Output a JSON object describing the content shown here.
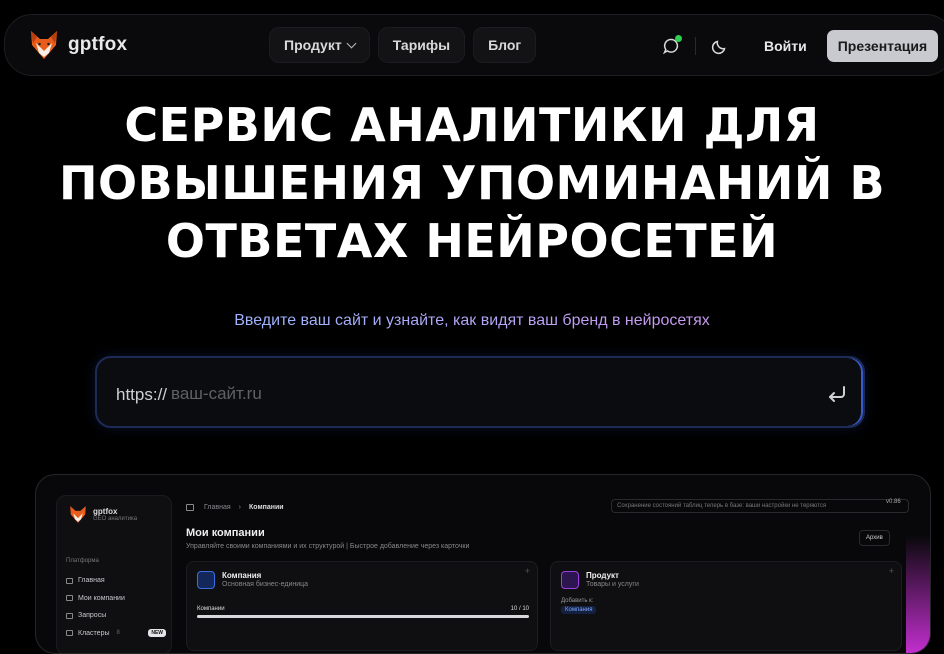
{
  "nav": {
    "logo_text": "gptfox",
    "menu": [
      {
        "label": "Продукт",
        "has_dropdown": true
      },
      {
        "label": "Тарифы",
        "has_dropdown": false
      },
      {
        "label": "Блог",
        "has_dropdown": false
      }
    ],
    "login_label": "Войти",
    "presentation_label": "Презентация",
    "icons": [
      "fox-logo-icon",
      "chat-bubble-icon",
      "moon-icon"
    ],
    "status_dot_color": "#2ccf4f"
  },
  "hero": {
    "title_lines": [
      "СЕРВИС АНАЛИТИКИ ДЛЯ",
      "ПОВЫШЕНИЯ УПОМИНАНИЙ В",
      "ОТВЕТАХ НЕЙРОСЕТЕЙ"
    ],
    "subtitle": "Введите ваш сайт и узнайте, как видят ваш бренд в нейросетях"
  },
  "search": {
    "prefix": "https://",
    "placeholder": "ваш-сайт.ru",
    "value": "",
    "submit_icon": "enter-return-icon"
  },
  "preview": {
    "brand": "gptfox",
    "brand_sub": "GEO аналитика",
    "section_label": "Платформа",
    "sidebar_items": [
      {
        "label": "Главная",
        "icon": "grid-icon"
      },
      {
        "label": "Мои компании",
        "icon": "folder-icon"
      },
      {
        "label": "Запросы",
        "icon": "search-icon"
      },
      {
        "label": "Кластеры",
        "icon": "layers-icon",
        "count": "8",
        "badge": "NEW"
      }
    ],
    "breadcrumb": [
      "Главная",
      "Компании"
    ],
    "save_note": "Сохранение состояний таблиц теперь в базе: ваши настройки не теряются",
    "version": "v0.86",
    "page_title": "Мои компании",
    "page_subtitle": "Управляйте своими компаниями и их структурой | Быстрое добавление через карточки",
    "archive_label": "Архив",
    "cards": [
      {
        "title": "Компания",
        "desc": "Основная бизнес-единица",
        "bar_label": "Компании",
        "bar_value": "10 / 10",
        "progress": 1.0,
        "icon_color": "#3b6fe0"
      },
      {
        "title": "Продукт",
        "desc": "Товары и услуги",
        "add_to_label": "Добавить к:",
        "tag": "Компания",
        "icon_color": "#9b3fe0"
      }
    ],
    "accent_glow": "#c52fd1"
  }
}
